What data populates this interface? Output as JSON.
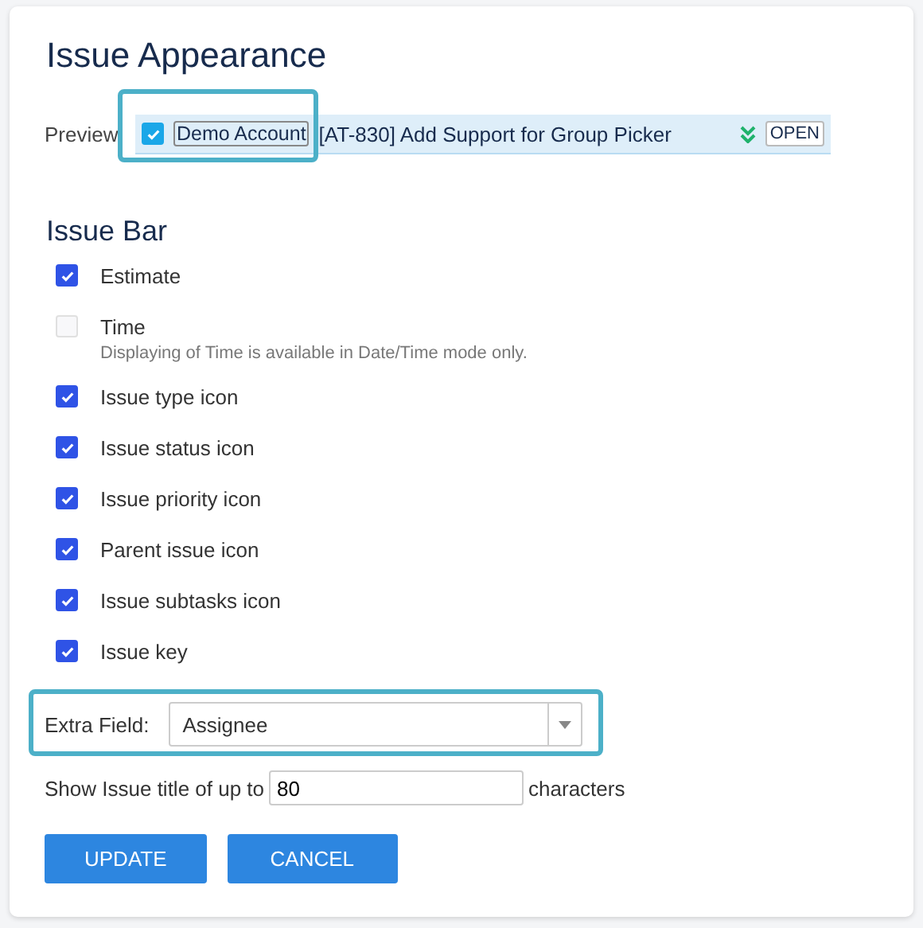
{
  "title": "Issue Appearance",
  "preview": {
    "label": "Preview",
    "checked": true,
    "account": "Demo Account",
    "summary": "[AT-830] Add Support for Group Picker",
    "status": "OPEN",
    "highlighted": true
  },
  "issue_bar": {
    "title": "Issue Bar",
    "options": [
      {
        "label": "Estimate",
        "checked": true,
        "disabled": false
      },
      {
        "label": "Time",
        "checked": false,
        "disabled": true,
        "note": "Displaying of Time is available in Date/Time mode only."
      },
      {
        "label": "Issue type icon",
        "checked": true,
        "disabled": false
      },
      {
        "label": "Issue status icon",
        "checked": true,
        "disabled": false
      },
      {
        "label": "Issue priority icon",
        "checked": true,
        "disabled": false
      },
      {
        "label": "Parent issue icon",
        "checked": true,
        "disabled": false
      },
      {
        "label": "Issue subtasks icon",
        "checked": true,
        "disabled": false
      },
      {
        "label": "Issue key",
        "checked": true,
        "disabled": false
      }
    ]
  },
  "extra_field": {
    "label": "Extra Field:",
    "value": "Assignee",
    "highlighted": true
  },
  "title_length": {
    "prefix": "Show Issue title of up to",
    "value": "80",
    "suffix": "characters"
  },
  "buttons": [
    "UPDATE",
    "CANCEL"
  ]
}
